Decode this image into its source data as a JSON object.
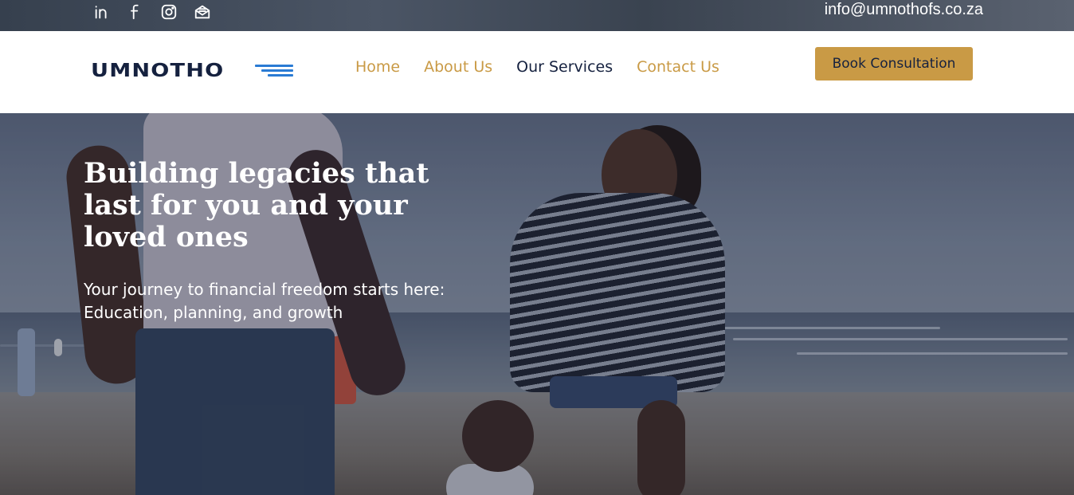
{
  "topbar": {
    "social_icons": [
      "linkedin-icon",
      "facebook-icon",
      "instagram-icon",
      "mail-icon"
    ],
    "email": "info@umnothofs.co.za"
  },
  "header": {
    "logo_text": "UMNOTHO",
    "nav": [
      {
        "label": "Home",
        "active": false
      },
      {
        "label": "About Us",
        "active": false
      },
      {
        "label": "Our Services",
        "active": true
      },
      {
        "label": "Contact Us",
        "active": false
      }
    ],
    "cta_label": "Book Consultation"
  },
  "hero": {
    "title_lines": [
      "Building legacies that",
      "last for you and your",
      "loved ones"
    ],
    "subtitle_lines": [
      "Your journey to financial freedom starts here:",
      "Education, planning, and growth"
    ]
  },
  "colors": {
    "accent_gold": "#c99a45",
    "navy": "#15213f",
    "logo_blue": "#2a7bd4",
    "logo_orange": "#e08a12"
  }
}
